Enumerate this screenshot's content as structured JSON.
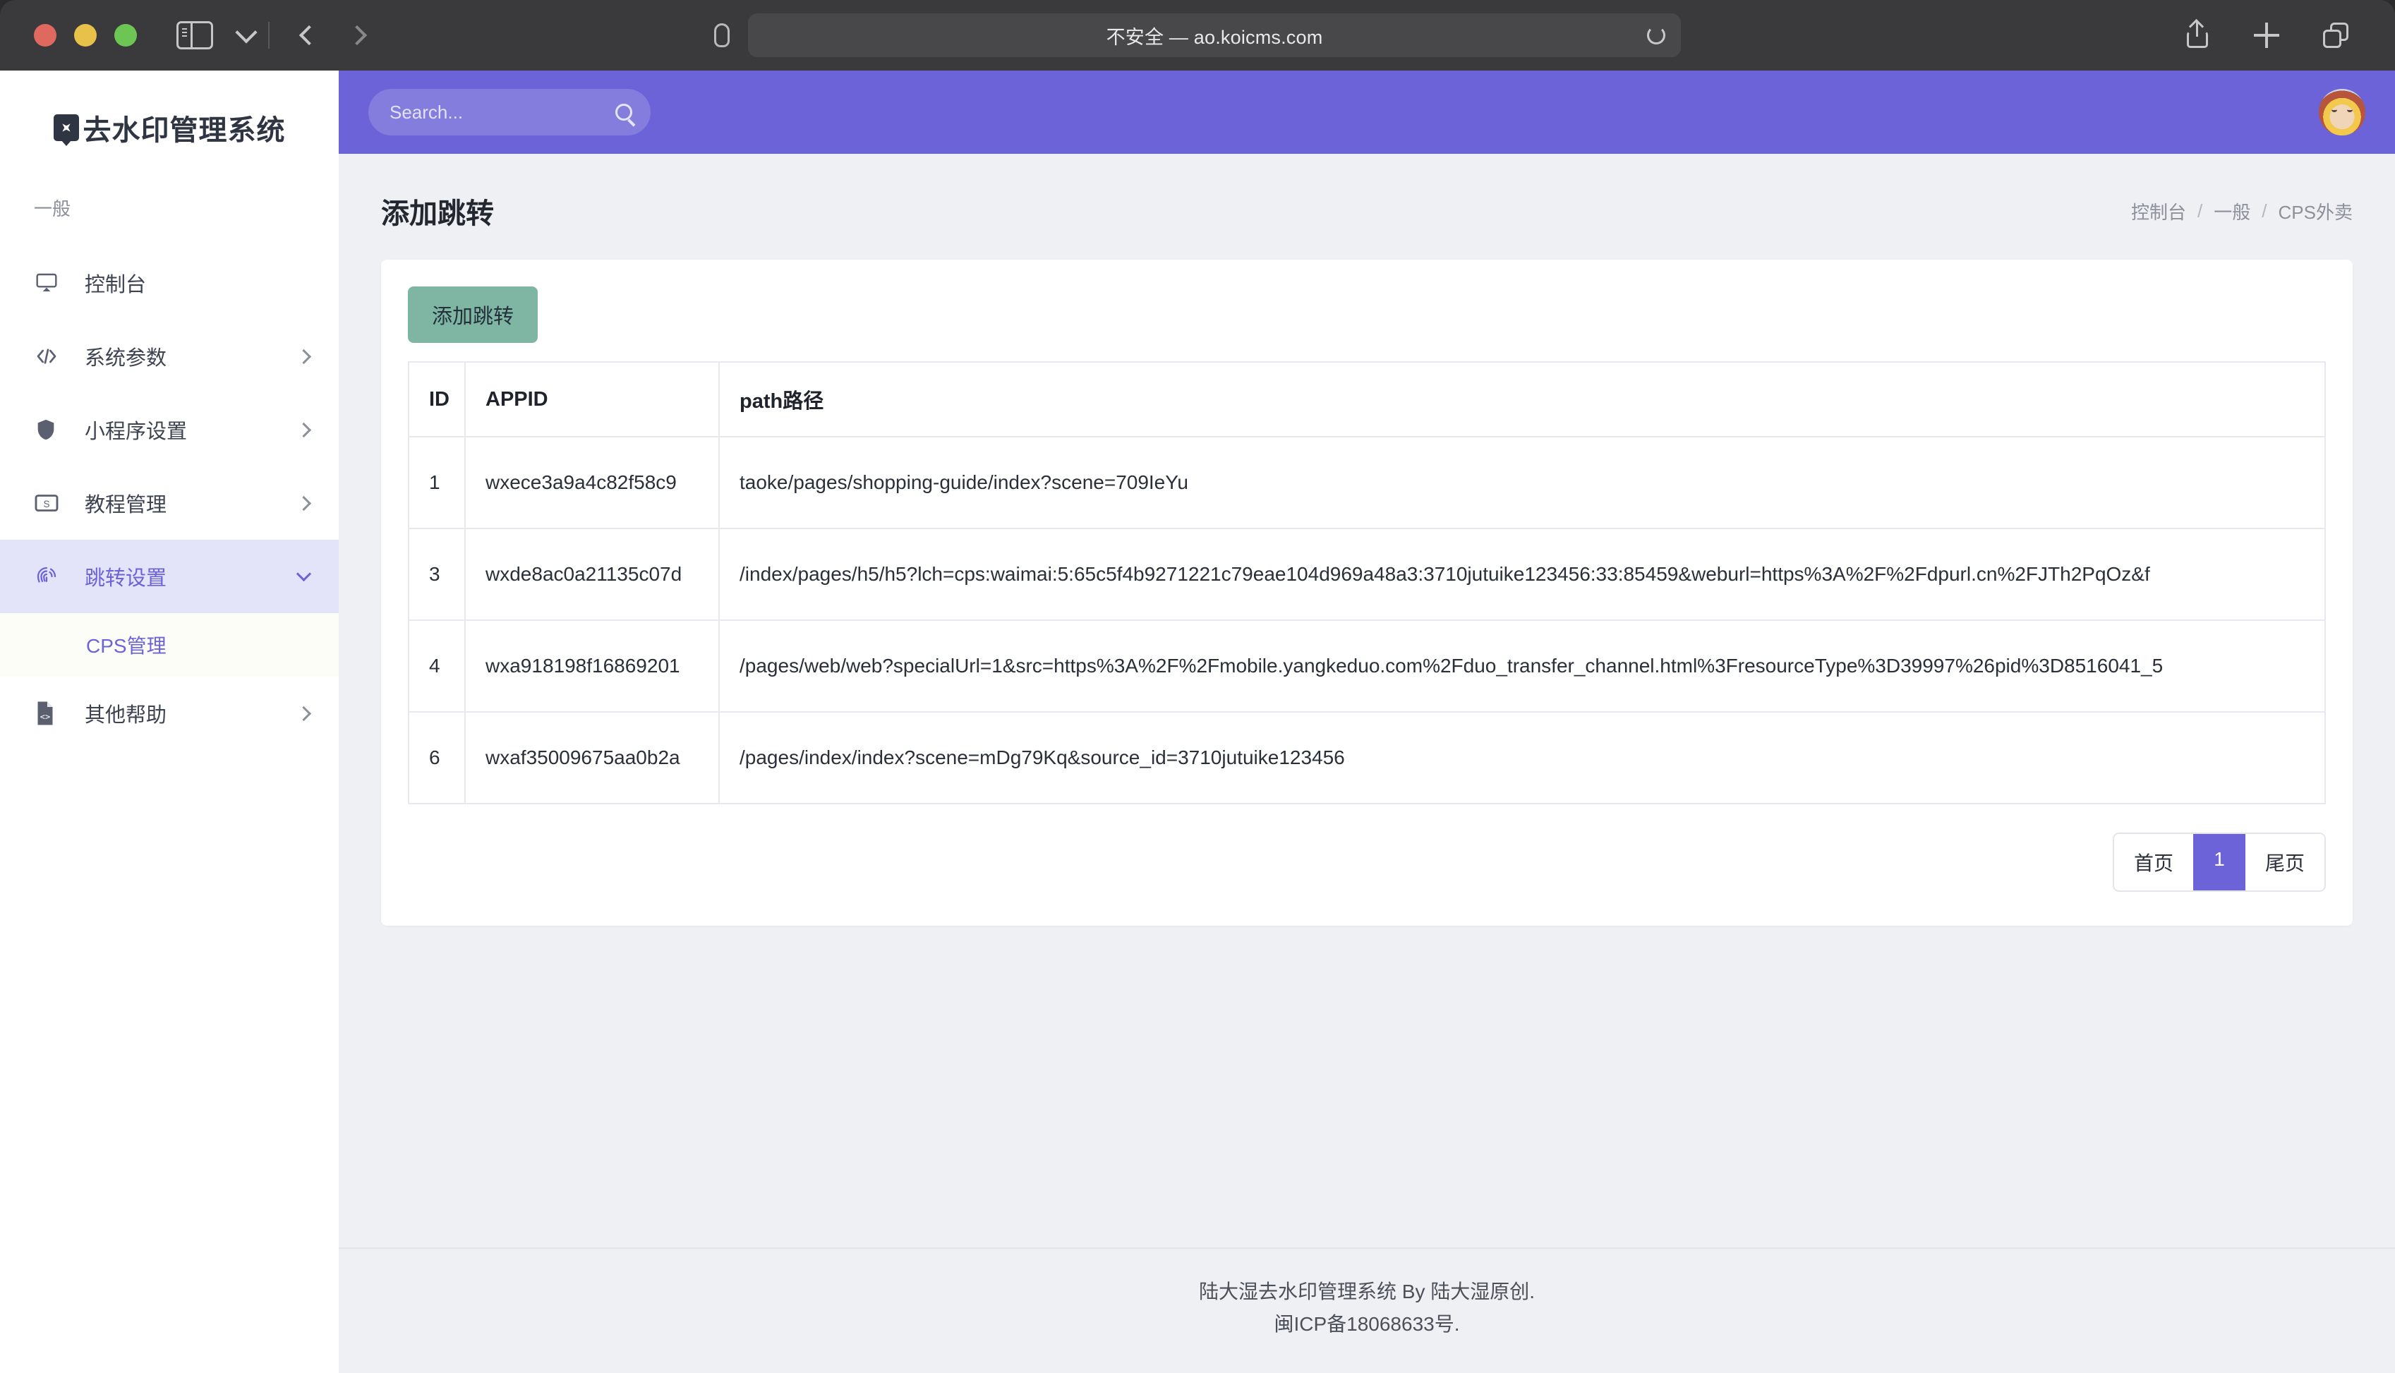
{
  "browser": {
    "url_text": "不安全 — ao.koicms.com",
    "icons": {
      "sidebar_toggle": "sidebar-toggle-icon",
      "chevron_down": "chevron-down-icon",
      "back": "back-arrow-icon",
      "forward": "forward-arrow-icon",
      "shield": "shield-icon",
      "reload": "reload-icon",
      "share": "share-icon",
      "new_tab": "plus-icon",
      "tab_overview": "tabs-icon"
    }
  },
  "sidebar": {
    "brand": "去水印管理系统",
    "brand_mark": "sparkle-badge-icon",
    "section_title": "一般",
    "items": [
      {
        "label": "控制台",
        "icon": "monitor-icon",
        "chevron": false,
        "active": false
      },
      {
        "label": "系统参数",
        "icon": "code-icon",
        "chevron": true,
        "active": false
      },
      {
        "label": "小程序设置",
        "icon": "shield-icon",
        "chevron": true,
        "active": false
      },
      {
        "label": "教程管理",
        "icon": "money-icon",
        "chevron": true,
        "active": false
      },
      {
        "label": "跳转设置",
        "icon": "fingerprint-icon",
        "chevron": true,
        "active": true
      },
      {
        "label": "其他帮助",
        "icon": "file-code-icon",
        "chevron": true,
        "active": false
      }
    ],
    "sub_item": {
      "label": "CPS管理",
      "parent": "跳转设置"
    }
  },
  "topbar": {
    "search_placeholder": "Search...",
    "search_value": "",
    "search_icon": "search-icon",
    "avatar": "user-avatar"
  },
  "main": {
    "title": "添加跳转",
    "breadcrumb": [
      "控制台",
      "一般",
      "CPS外卖"
    ],
    "breadcrumb_separator": "/",
    "add_button": "添加跳转",
    "table": {
      "columns": [
        "ID",
        "APPID",
        "path路径"
      ],
      "rows": [
        {
          "id": "1",
          "appid": "wxece3a9a4c82f58c9",
          "path": "taoke/pages/shopping-guide/index?scene=709IeYu"
        },
        {
          "id": "3",
          "appid": "wxde8ac0a21135c07d",
          "path": "/index/pages/h5/h5?lch=cps:waimai:5:65c5f4b9271221c79eae104d969a48a3:3710jutuike123456:33:85459&weburl=https%3A%2F%2Fdpurl.cn%2FJTh2PqOz&f"
        },
        {
          "id": "4",
          "appid": "wxa918198f16869201",
          "path": "/pages/web/web?specialUrl=1&src=https%3A%2F%2Fmobile.yangkeduo.com%2Fduo_transfer_channel.html%3FresourceType%3D39997%26pid%3D8516041_5"
        },
        {
          "id": "6",
          "appid": "wxaf35009675aa0b2a",
          "path": "/pages/index/index?scene=mDg79Kq&source_id=3710jutuike123456"
        }
      ]
    },
    "pagination": {
      "first": "首页",
      "current": "1",
      "last": "尾页"
    }
  },
  "footer": {
    "line1": "陆大湿去水印管理系统 By 陆大湿原创.",
    "line2": "闽ICP备18068633号."
  },
  "colors": {
    "accent": "#6c63d8",
    "accent_soft": "#e3e3fa",
    "add_button": "#7fb5a3",
    "page_bg": "#eef0f4",
    "chrome": "#3a3a3c"
  }
}
